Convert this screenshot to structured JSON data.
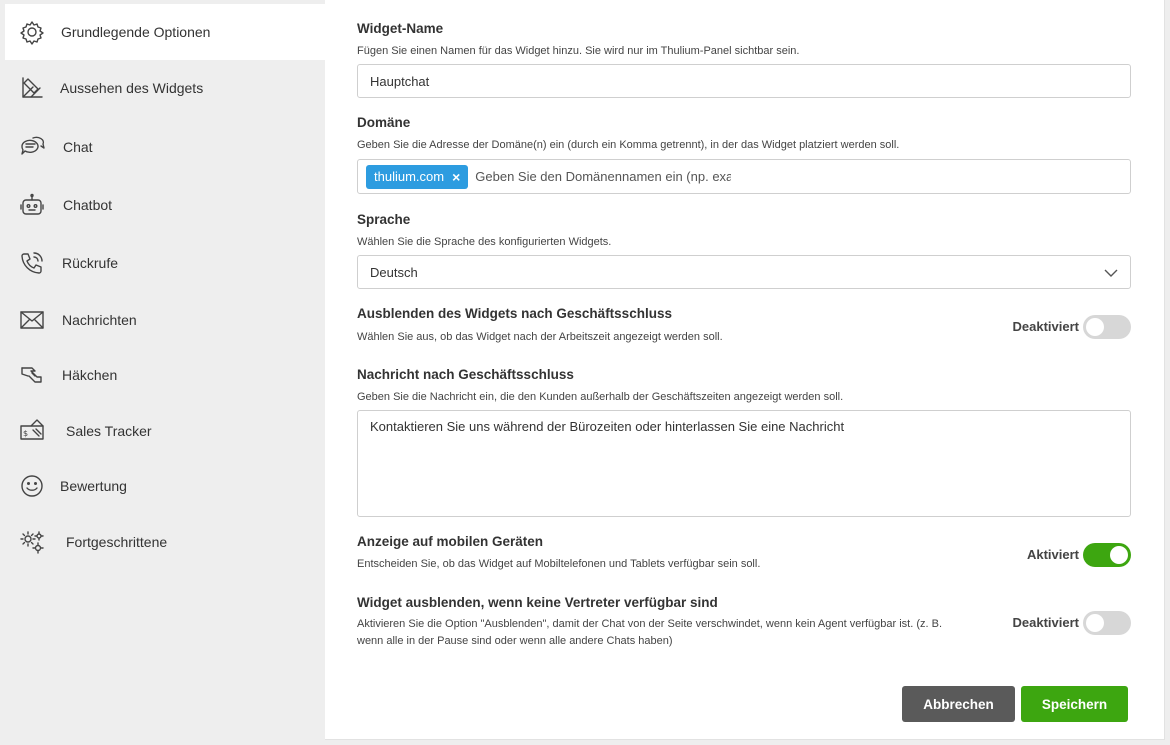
{
  "sidebar": {
    "items": [
      {
        "label": "Grundlegende Optionen",
        "icon": "gear-icon"
      },
      {
        "label": "Aussehen des Widgets",
        "icon": "palette-icon"
      },
      {
        "label": "Chat",
        "icon": "chat-bubbles-icon"
      },
      {
        "label": "Chatbot",
        "icon": "robot-icon"
      },
      {
        "label": "Rückrufe",
        "icon": "phone-callback-icon"
      },
      {
        "label": "Nachrichten",
        "icon": "envelope-icon"
      },
      {
        "label": "Häkchen",
        "icon": "hand-icon"
      },
      {
        "label": "Sales Tracker",
        "icon": "money-ticket-icon"
      },
      {
        "label": "Bewertung",
        "icon": "smiley-icon"
      },
      {
        "label": "Fortgeschrittene",
        "icon": "gears-icon"
      }
    ]
  },
  "form": {
    "widget_name": {
      "title": "Widget-Name",
      "desc": "Fügen Sie einen Namen für das Widget hinzu. Sie wird nur im Thulium-Panel sichtbar sein.",
      "value": "Hauptchat"
    },
    "domain": {
      "title": "Domäne",
      "desc": "Geben Sie die Adresse der Domäne(n) ein (durch ein Komma getrennt), in der das Widget platziert werden soll.",
      "tag": "thulium.com",
      "tag_remove": "×",
      "placeholder": "Geben Sie den Domänennamen ein (np. example.com)"
    },
    "language": {
      "title": "Sprache",
      "desc": "Wählen Sie die Sprache des konfigurierten Widgets.",
      "value": "Deutsch"
    },
    "hide_after_hours": {
      "title": "Ausblenden des Widgets nach Geschäftsschluss",
      "desc": "Wählen Sie aus, ob das Widget nach der Arbeitszeit angezeigt werden soll.",
      "state_label": "Deaktiviert",
      "enabled": false
    },
    "after_hours_message": {
      "title": "Nachricht nach Geschäftsschluss",
      "desc": "Geben Sie die Nachricht ein, die den Kunden außerhalb der Geschäftszeiten angezeigt werden soll.",
      "value": "Kontaktieren Sie uns während der Bürozeiten oder hinterlassen Sie eine Nachricht"
    },
    "mobile_display": {
      "title": "Anzeige auf mobilen Geräten",
      "desc": "Entscheiden Sie, ob das Widget auf Mobiltelefonen und Tablets verfügbar sein soll.",
      "state_label": "Aktiviert",
      "enabled": true
    },
    "hide_no_agents": {
      "title": "Widget ausblenden, wenn keine Vertreter verfügbar sind",
      "desc_line1": "Aktivieren Sie die Option \"Ausblenden\", damit der Chat von der Seite verschwindet, wenn kein Agent verfügbar ist. (z. B.",
      "desc_line2": "wenn alle in der Pause sind oder wenn alle andere Chats haben)",
      "state_label": "Deaktiviert",
      "enabled": false
    }
  },
  "buttons": {
    "cancel": "Abbrechen",
    "save": "Speichern"
  },
  "colors": {
    "accent_green": "#3da610",
    "tag_blue": "#2d9ce0",
    "cancel_gray": "#5a5a5a"
  }
}
